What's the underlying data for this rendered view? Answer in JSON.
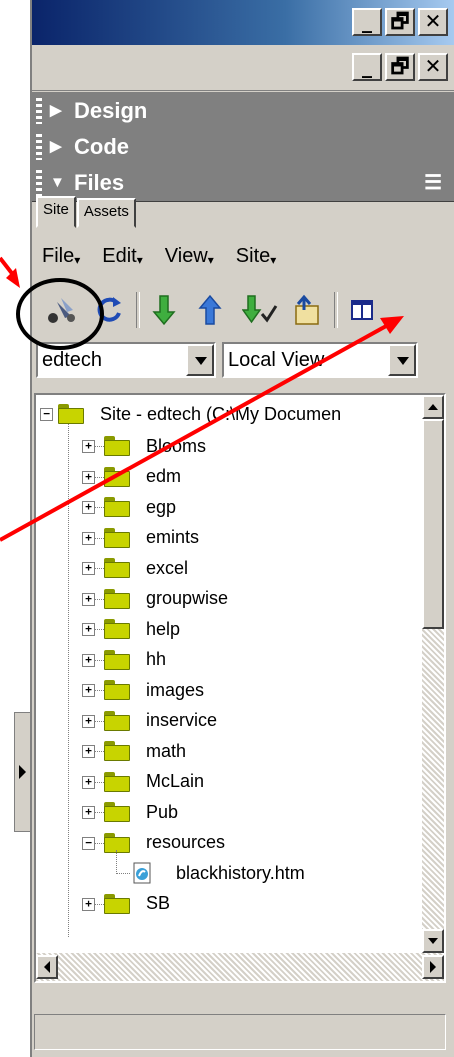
{
  "window": {
    "buttons": [
      "_",
      "🗗",
      "✕"
    ]
  },
  "panels": [
    {
      "label": "Design",
      "state": "collapsed"
    },
    {
      "label": "Code",
      "state": "collapsed"
    },
    {
      "label": "Files",
      "state": "expanded",
      "options_icon": "options-menu-icon"
    }
  ],
  "tabs": [
    {
      "label": "Site",
      "active": true
    },
    {
      "label": "Assets",
      "active": false
    }
  ],
  "menu": [
    "File",
    "Edit",
    "View",
    "Site"
  ],
  "toolbar": [
    "connect-icon",
    "refresh-icon",
    "get-files-icon",
    "put-files-icon",
    "check-out-icon",
    "check-in-icon",
    "expand-icon"
  ],
  "site_select": {
    "value": "edtech"
  },
  "view_select": {
    "value": "Local View"
  },
  "tree": {
    "root": "Site - edtech (C:\\My Documen",
    "folders": [
      {
        "name": "Blooms",
        "expanded": false
      },
      {
        "name": "edm",
        "expanded": false
      },
      {
        "name": "egp",
        "expanded": false
      },
      {
        "name": "emints",
        "expanded": false
      },
      {
        "name": "excel",
        "expanded": false
      },
      {
        "name": "groupwise",
        "expanded": false
      },
      {
        "name": "help",
        "expanded": false
      },
      {
        "name": "hh",
        "expanded": false
      },
      {
        "name": "images",
        "expanded": false
      },
      {
        "name": "inservice",
        "expanded": false
      },
      {
        "name": "math",
        "expanded": false
      },
      {
        "name": "McLain",
        "expanded": false
      },
      {
        "name": "Pub",
        "expanded": false
      },
      {
        "name": "resources",
        "expanded": true,
        "children": [
          "blackhistory.htm"
        ]
      },
      {
        "name": "SB",
        "expanded": false
      }
    ]
  },
  "colors": {
    "panel_bg": "#d4d0c8",
    "header_bg": "#808080",
    "annotation": "#ff0000",
    "folder": "#c8d400"
  }
}
